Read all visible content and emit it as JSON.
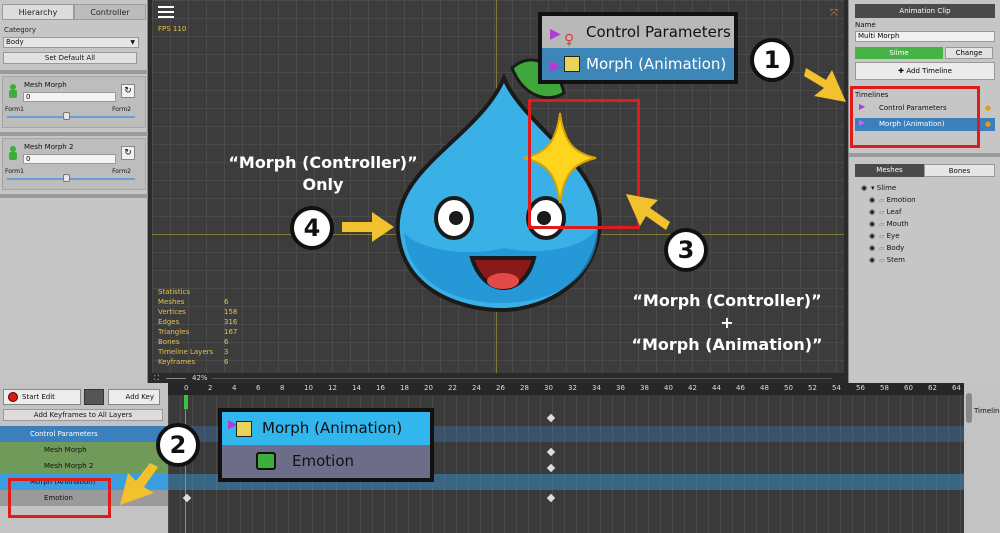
{
  "left_panel": {
    "tabs": [
      "Hierarchy",
      "Controller"
    ],
    "category_label": "Category",
    "category_value": "Body",
    "set_default_label": "Set Default All",
    "morphs": [
      {
        "name": "Mesh Morph",
        "value": "0",
        "form1": "Form1",
        "form2": "Form2"
      },
      {
        "name": "Mesh Morph 2",
        "value": "0",
        "form1": "Form1",
        "form2": "Form2"
      }
    ]
  },
  "viewport": {
    "fps": "FPS 110",
    "zoom": "42%",
    "statistics_title": "Statistics",
    "stats": [
      {
        "k": "Meshes",
        "v": "6"
      },
      {
        "k": "Vertices",
        "v": "158"
      },
      {
        "k": "Edges",
        "v": "316"
      },
      {
        "k": "Triangles",
        "v": "167"
      },
      {
        "k": "Bones",
        "v": "6"
      },
      {
        "k": "Timeline Layers",
        "v": "3"
      },
      {
        "k": "Keyframes",
        "v": "6"
      }
    ],
    "popup_top": [
      "Control Parameters",
      "Morph (Animation)"
    ],
    "popup_mid": [
      "Morph (Animation)",
      "Emotion"
    ],
    "callout4_line1": "“Morph (Controller)”",
    "callout4_line2": "Only",
    "callout3_line1": "“Morph (Controller)”",
    "callout3_line2": "+",
    "callout3_line3": "“Morph (Animation)”",
    "numbers": [
      "1",
      "2",
      "3",
      "4"
    ]
  },
  "right_panel": {
    "header": "Animation Clip",
    "name_label": "Name",
    "name_value": "Multi Morph",
    "slime_label": "Slime",
    "change_label": "Change",
    "add_timeline_label": "Add Timeline",
    "timelines_label": "Timelines",
    "timelines": [
      "Control Parameters",
      "Morph (Animation)"
    ],
    "tabs": [
      "Meshes",
      "Bones"
    ],
    "meshes": [
      "Slime",
      "Emotion",
      "Leaf",
      "Mouth",
      "Eye",
      "Body",
      "Stem"
    ]
  },
  "timeline": {
    "start_edit_label": "Start Edit",
    "add_key_label": "Add Key",
    "add_all_label": "Add Keyframes to All Layers",
    "layers": [
      "Control Parameters",
      "Mesh Morph",
      "Mesh Morph 2",
      "Morph (Animation)",
      "Emotion"
    ],
    "ticks": [
      "0",
      "2",
      "4",
      "6",
      "8",
      "10",
      "12",
      "14",
      "16",
      "18",
      "20",
      "22",
      "24",
      "26",
      "28",
      "30",
      "32",
      "34",
      "36",
      "38",
      "40",
      "42",
      "44",
      "46",
      "48",
      "50",
      "52",
      "54",
      "56",
      "58",
      "60",
      "62",
      "64"
    ],
    "right_label": "Timeline"
  },
  "colors": {
    "accent_red": "#e01b1b",
    "arrow_yellow": "#f2c12e",
    "selected_blue": "#3b7fbd",
    "green": "#47b347"
  }
}
